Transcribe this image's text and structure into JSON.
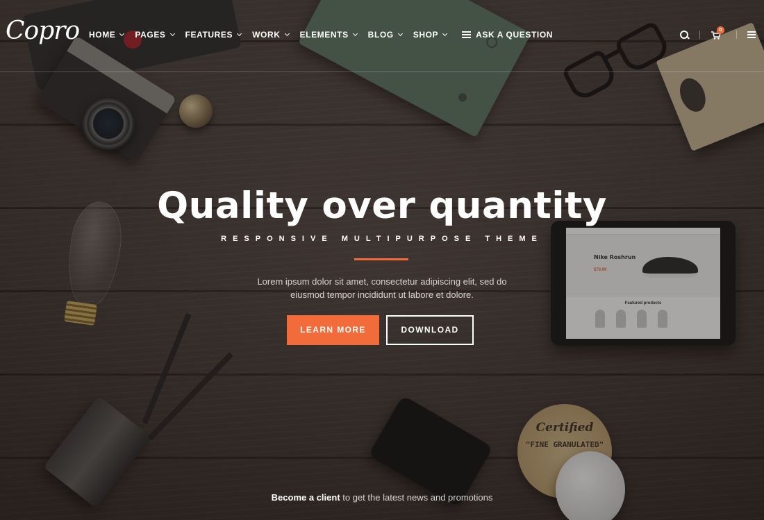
{
  "brand": {
    "logo_text": "Copro"
  },
  "nav": {
    "items": [
      {
        "label": "HOME"
      },
      {
        "label": "PAGES"
      },
      {
        "label": "FEATURES"
      },
      {
        "label": "WORK"
      },
      {
        "label": "ELEMENTS"
      },
      {
        "label": "BLOG"
      },
      {
        "label": "SHOP"
      }
    ],
    "ask_label": "ASK A QUESTION"
  },
  "header_tools": {
    "cart_count": "0"
  },
  "hero": {
    "title": "Quality over quantity",
    "subtitle": "RESPONSIVE MULTIPURPOSE THEME",
    "text": "Lorem ipsum dolor sit amet, consectetur adipiscing elit, sed do eiusmod tempor incididunt ut labore et dolore.",
    "primary_button": "LEARN MORE",
    "secondary_button": "DOWNLOAD"
  },
  "tablet": {
    "product_title": "Nike Roshrun",
    "product_price": "$79,99",
    "section_title": "Featured products"
  },
  "coaster": {
    "line1": "Certified",
    "line2": "\"FINE GRANULATED\""
  },
  "footer": {
    "cta_strong": "Become a client",
    "cta_rest": " to get the latest news and promotions"
  },
  "colors": {
    "accent": "#f26b3a",
    "text": "#ffffff"
  }
}
